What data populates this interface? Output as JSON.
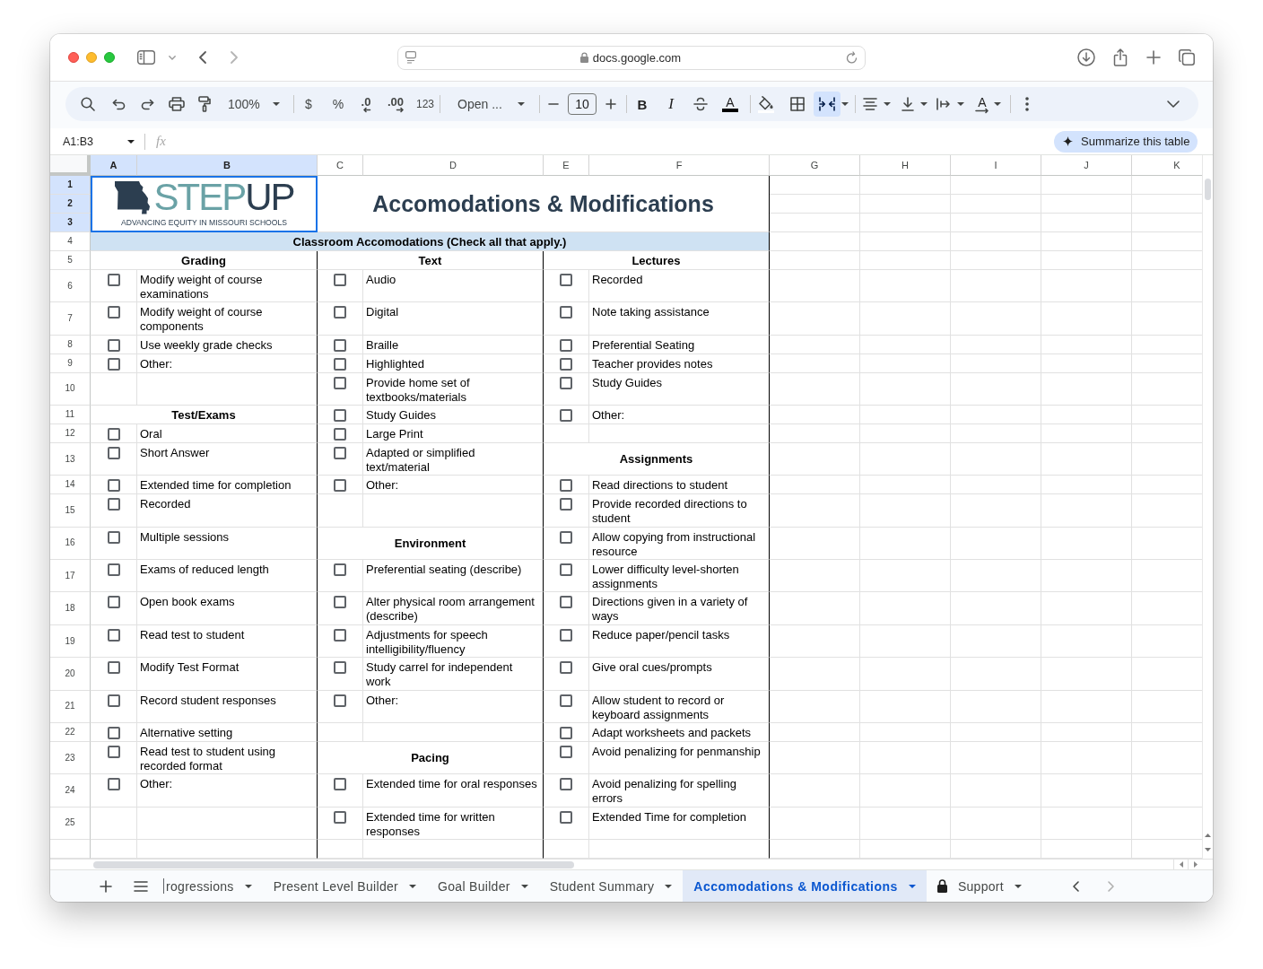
{
  "browser": {
    "address": "docs.google.com"
  },
  "toolbar": {
    "zoom": "100%",
    "currency": "$",
    "percent": "%",
    "decrease_decimal": ".0",
    "increase_decimal": ".00",
    "number_format": "123",
    "font": "Open ...",
    "font_size": "10",
    "bold": "B",
    "italic": "I",
    "text_color": "A",
    "merge_cells_on": true,
    "text_rotation": "A"
  },
  "formula_bar": {
    "cell_range": "A1:B3",
    "function_label": "fx",
    "summarize_button": "Summarize this table"
  },
  "sheet": {
    "columns": [
      {
        "label": "A",
        "selected": true
      },
      {
        "label": "B",
        "selected": true
      },
      {
        "label": "C",
        "selected": false
      },
      {
        "label": "D",
        "selected": false
      },
      {
        "label": "E",
        "selected": false
      },
      {
        "label": "F",
        "selected": false
      },
      {
        "label": "G",
        "selected": false
      },
      {
        "label": "H",
        "selected": false
      },
      {
        "label": "I",
        "selected": false
      },
      {
        "label": "J",
        "selected": false
      },
      {
        "label": "K",
        "selected": false
      }
    ],
    "logo": {
      "word_light": "STEP",
      "word_dark": "UP",
      "tagline": "ADVANCING EQUITY IN MISSOURI SCHOOLS"
    },
    "title": "Accomodations & Modifications",
    "banner": "Classroom Accomodations (Check all that apply.)",
    "rows": [
      {
        "number": "1",
        "selected": true
      },
      {
        "number": "2",
        "selected": true
      },
      {
        "number": "3",
        "selected": true
      },
      {
        "number": "4",
        "selected": false
      },
      {
        "number": "5",
        "selected": false,
        "groups": [
          {
            "kind": "heading",
            "text": "Grading"
          },
          {
            "kind": "heading",
            "text": "Text"
          },
          {
            "kind": "heading",
            "text": "Lectures"
          }
        ]
      },
      {
        "number": "6",
        "selected": false,
        "groups": [
          {
            "kind": "item",
            "label": "Modify weight of course examinations",
            "checked": false
          },
          {
            "kind": "item",
            "label": "Audio",
            "checked": false
          },
          {
            "kind": "item",
            "label": "Recorded",
            "checked": false
          }
        ]
      },
      {
        "number": "7",
        "selected": false,
        "groups": [
          {
            "kind": "item",
            "label": "Modify weight of course components",
            "checked": false
          },
          {
            "kind": "item",
            "label": "Digital",
            "checked": false
          },
          {
            "kind": "item",
            "label": "Note taking assistance",
            "checked": false
          }
        ]
      },
      {
        "number": "8",
        "selected": false,
        "groups": [
          {
            "kind": "item",
            "label": "Use weekly grade checks",
            "checked": false
          },
          {
            "kind": "item",
            "label": "Braille",
            "checked": false
          },
          {
            "kind": "item",
            "label": "Preferential Seating",
            "checked": false
          }
        ]
      },
      {
        "number": "9",
        "selected": false,
        "groups": [
          {
            "kind": "item",
            "label": "Other:",
            "checked": false
          },
          {
            "kind": "item",
            "label": "Highlighted",
            "checked": false
          },
          {
            "kind": "item",
            "label": "Teacher provides notes",
            "checked": false
          }
        ]
      },
      {
        "number": "10",
        "selected": false,
        "groups": [
          {
            "kind": "empty"
          },
          {
            "kind": "item",
            "label": "Provide home set of textbooks/materials",
            "checked": false
          },
          {
            "kind": "item",
            "label": "Study Guides",
            "checked": false
          }
        ]
      },
      {
        "number": "11",
        "selected": false,
        "groups": [
          {
            "kind": "heading",
            "text": "Test/Exams"
          },
          {
            "kind": "item",
            "label": "Study Guides",
            "checked": false
          },
          {
            "kind": "item",
            "label": "Other:",
            "checked": false
          }
        ]
      },
      {
        "number": "12",
        "selected": false,
        "groups": [
          {
            "kind": "item",
            "label": "Oral",
            "checked": false
          },
          {
            "kind": "item",
            "label": "Large Print",
            "checked": false
          },
          {
            "kind": "empty"
          }
        ]
      },
      {
        "number": "13",
        "selected": false,
        "groups": [
          {
            "kind": "item",
            "label": "Short Answer",
            "checked": false
          },
          {
            "kind": "item",
            "label": "Adapted or simplified text/material",
            "checked": false
          },
          {
            "kind": "heading",
            "text": "Assignments"
          }
        ]
      },
      {
        "number": "14",
        "selected": false,
        "groups": [
          {
            "kind": "item",
            "label": "Extended time for completion",
            "checked": false
          },
          {
            "kind": "item",
            "label": "Other:",
            "checked": false
          },
          {
            "kind": "item",
            "label": "Read directions to student",
            "checked": false
          }
        ]
      },
      {
        "number": "15",
        "selected": false,
        "groups": [
          {
            "kind": "item",
            "label": "Recorded",
            "checked": false
          },
          {
            "kind": "empty"
          },
          {
            "kind": "item",
            "label": "Provide recorded directions to student",
            "checked": false
          }
        ]
      },
      {
        "number": "16",
        "selected": false,
        "groups": [
          {
            "kind": "item",
            "label": "Multiple sessions",
            "checked": false
          },
          {
            "kind": "heading",
            "text": "Environment"
          },
          {
            "kind": "item",
            "label": "Allow copying from instructional resource",
            "checked": false
          }
        ]
      },
      {
        "number": "17",
        "selected": false,
        "groups": [
          {
            "kind": "item",
            "label": "Exams of reduced length",
            "checked": false
          },
          {
            "kind": "item",
            "label": "Preferential seating (describe)",
            "checked": false
          },
          {
            "kind": "item",
            "label": "Lower difficulty level-shorten assignments",
            "checked": false
          }
        ]
      },
      {
        "number": "18",
        "selected": false,
        "groups": [
          {
            "kind": "item",
            "label": "Open book exams",
            "checked": false
          },
          {
            "kind": "item",
            "label": "Alter physical room arrangement (describe)",
            "checked": false
          },
          {
            "kind": "item",
            "label": "Directions given in a variety of ways",
            "checked": false
          }
        ]
      },
      {
        "number": "19",
        "selected": false,
        "groups": [
          {
            "kind": "item",
            "label": "Read test to student",
            "checked": false
          },
          {
            "kind": "item",
            "label": "Adjustments for speech intelligibility/fluency",
            "checked": false
          },
          {
            "kind": "item",
            "label": "Reduce paper/pencil tasks",
            "checked": false
          }
        ]
      },
      {
        "number": "20",
        "selected": false,
        "groups": [
          {
            "kind": "item",
            "label": "Modify Test Format",
            "checked": false
          },
          {
            "kind": "item",
            "label": "Study carrel for independent work",
            "checked": false
          },
          {
            "kind": "item",
            "label": "Give oral cues/prompts",
            "checked": false
          }
        ]
      },
      {
        "number": "21",
        "selected": false,
        "groups": [
          {
            "kind": "item",
            "label": "Record student responses",
            "checked": false
          },
          {
            "kind": "item",
            "label": "Other:",
            "checked": false
          },
          {
            "kind": "item",
            "label": "Allow student to record or keyboard assignments",
            "checked": false
          }
        ]
      },
      {
        "number": "22",
        "selected": false,
        "groups": [
          {
            "kind": "item",
            "label": "Alternative setting",
            "checked": false
          },
          {
            "kind": "empty"
          },
          {
            "kind": "item",
            "label": "Adapt worksheets and packets",
            "checked": false
          }
        ]
      },
      {
        "number": "23",
        "selected": false,
        "groups": [
          {
            "kind": "item",
            "label": "Read test to student using recorded format",
            "checked": false
          },
          {
            "kind": "heading",
            "text": "Pacing"
          },
          {
            "kind": "item",
            "label": "Avoid penalizing for penmanship",
            "checked": false
          }
        ]
      },
      {
        "number": "24",
        "selected": false,
        "groups": [
          {
            "kind": "item",
            "label": "Other:",
            "checked": false
          },
          {
            "kind": "item",
            "label": "Extended time for oral responses",
            "checked": false
          },
          {
            "kind": "item",
            "label": "Avoid penalizing for spelling errors",
            "checked": false
          }
        ]
      },
      {
        "number": "25",
        "selected": false,
        "groups": [
          {
            "kind": "empty"
          },
          {
            "kind": "item",
            "label": "Extended time for written responses",
            "checked": false
          },
          {
            "kind": "item",
            "label": "Extended Time for completion",
            "checked": false
          }
        ]
      }
    ]
  },
  "sheet_tabs": [
    {
      "label": "rogressions",
      "selected": false,
      "locked": false
    },
    {
      "label": "Present Level Builder",
      "selected": false,
      "locked": false
    },
    {
      "label": "Goal Builder",
      "selected": false,
      "locked": false
    },
    {
      "label": "Student Summary",
      "selected": false,
      "locked": false
    },
    {
      "label": "Accomodations & Modifications",
      "selected": true,
      "locked": false
    },
    {
      "label": "Support",
      "selected": false,
      "locked": true
    }
  ]
}
